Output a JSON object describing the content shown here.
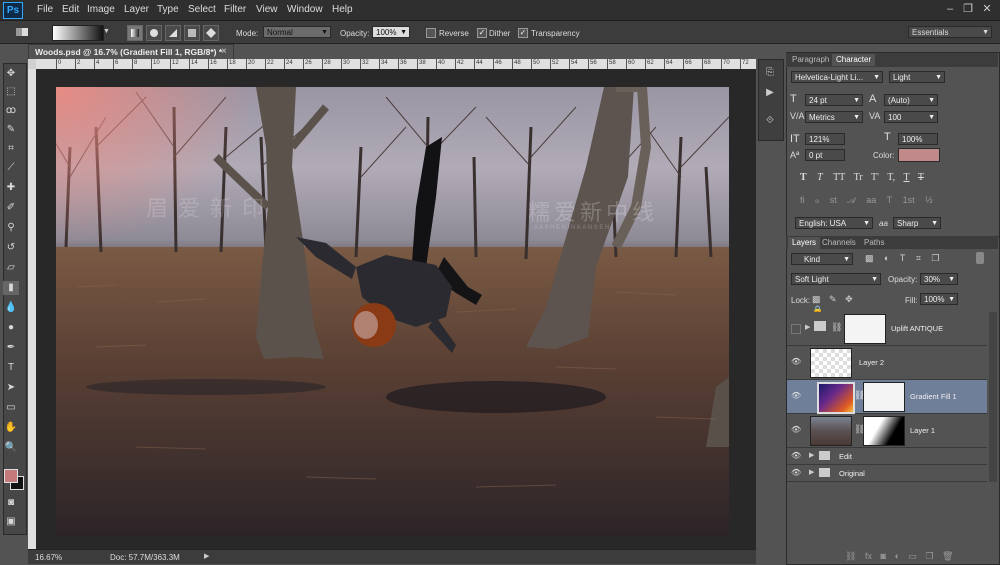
{
  "app": {
    "logo": "Ps"
  },
  "menubar": {
    "items": [
      "File",
      "Edit",
      "Image",
      "Layer",
      "Type",
      "Select",
      "Filter",
      "View",
      "Window",
      "Help"
    ]
  },
  "window_controls": {
    "minimize": "–",
    "restore": "❐",
    "close": "✕"
  },
  "options": {
    "mode_label": "Mode:",
    "mode_value": "Normal",
    "opacity_label": "Opacity:",
    "opacity_value": "100%",
    "reverse_label": "Reverse",
    "reverse_checked": false,
    "dither_label": "Dither",
    "dither_checked": true,
    "transparency_label": "Transparency",
    "transparency_checked": true,
    "workspace": "Essentials"
  },
  "document": {
    "tab_title": "Woods.psd @ 16.7% (Gradient Fill 1, RGB/8*) *",
    "tab_close": "×",
    "ruler_ticks": [
      "0",
      "2",
      "4",
      "6",
      "8",
      "10",
      "12",
      "14",
      "16",
      "18",
      "20",
      "22",
      "24",
      "26",
      "28",
      "30",
      "32",
      "34",
      "36",
      "38",
      "40",
      "42",
      "44",
      "46",
      "48",
      "50",
      "52",
      "54",
      "56",
      "58",
      "60",
      "62",
      "64",
      "66",
      "68",
      "70",
      "72"
    ],
    "zoom": "16.67%",
    "doc_info": "Doc: 57.7M/363.3M"
  },
  "watermark": {
    "left": "眉爱新印",
    "right": "糯爱新中线",
    "sub": "A A S H E N I N K A N S E N"
  },
  "character_panel": {
    "tabs": [
      "Paragraph",
      "Character"
    ],
    "font_family": "Helvetica-Light Li...",
    "font_style": "Light",
    "font_size": "24 pt",
    "leading": "(Auto)",
    "kerning": "Metrics",
    "tracking": "100",
    "vertical_scale": "121%",
    "horizontal_scale": "100%",
    "baseline_shift": "0 pt",
    "color_label": "Color:",
    "color_swatch": "#c08a8a",
    "style_buttons": [
      "T",
      "T",
      "TT",
      "Tr",
      "T'",
      "T,",
      "T",
      "T"
    ],
    "language": "English: USA",
    "antialias_a": "a",
    "antialias_a2": "a",
    "antialias": "Sharp"
  },
  "layers_panel": {
    "tabs": [
      "Layers",
      "Channels",
      "Paths"
    ],
    "filter_kind": "Kind",
    "blend_mode": "Soft Light",
    "opacity_label": "Opacity:",
    "opacity_value": "30%",
    "lock_label": "Lock:",
    "fill_label": "Fill:",
    "fill_value": "100%",
    "layers": [
      {
        "name": "Uplift ANTIQUE",
        "visible": false
      },
      {
        "name": "Layer 2",
        "visible": true
      },
      {
        "name": "Gradient Fill 1",
        "visible": true,
        "selected": true
      },
      {
        "name": "Layer 1",
        "visible": true
      }
    ],
    "groups": [
      "Edit",
      "Original"
    ]
  },
  "colors": {
    "foreground": "#c47a7a",
    "background": "#111111",
    "accent": "#31a8ff",
    "selected_row": "#6f7f9a"
  }
}
